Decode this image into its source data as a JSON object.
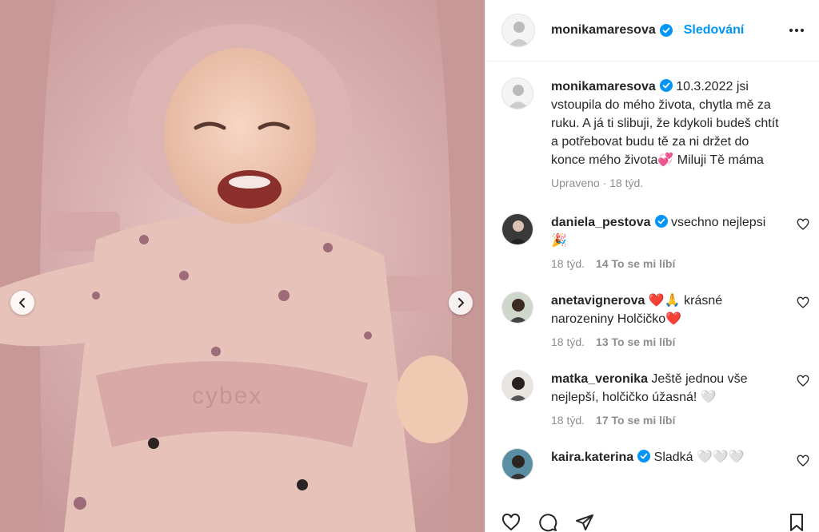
{
  "header": {
    "username": "monikamaresova",
    "follow_label": "Sledování"
  },
  "caption": {
    "username": "monikamaresova",
    "text": "10.3.2022 jsi vstoupila do mého života, chytla mě za ruku. A já ti slibuji, že kdykoli budeš chtít a potřebovat budu tě za ni držet do konce mého života💞 Miluji Tě máma",
    "edited_label": "Upraveno · 18 týd."
  },
  "comments": [
    {
      "username": "daniela_pestova",
      "verified": true,
      "text": "vsechno nejlepsi 🎉",
      "age": "18 týd.",
      "likes": "14 To se mi líbí"
    },
    {
      "username": "anetavignerova",
      "verified": false,
      "text": "❤️🙏 krásné narozeniny Holčičko❤️",
      "age": "18 týd.",
      "likes": "13 To se mi líbí"
    },
    {
      "username": "matka_veronika",
      "verified": false,
      "text": "Ještě jednou vše nejlepší, holčičko úžasná! 🤍",
      "age": "18 týd.",
      "likes": "17 To se mi líbí"
    },
    {
      "username": "kaira.katerina",
      "verified": true,
      "text": "Sladká 🤍🤍🤍",
      "age": "",
      "likes": ""
    }
  ],
  "photo": {
    "brand_text": "cybex"
  },
  "colors": {
    "accent": "#0095f6",
    "verified": "#0095f6",
    "muted": "#8e8e8e"
  },
  "icons": [
    "chevron-left-icon",
    "chevron-right-icon",
    "more-icon",
    "verified-icon",
    "heart-icon",
    "comment-icon",
    "share-icon",
    "bookmark-icon"
  ]
}
